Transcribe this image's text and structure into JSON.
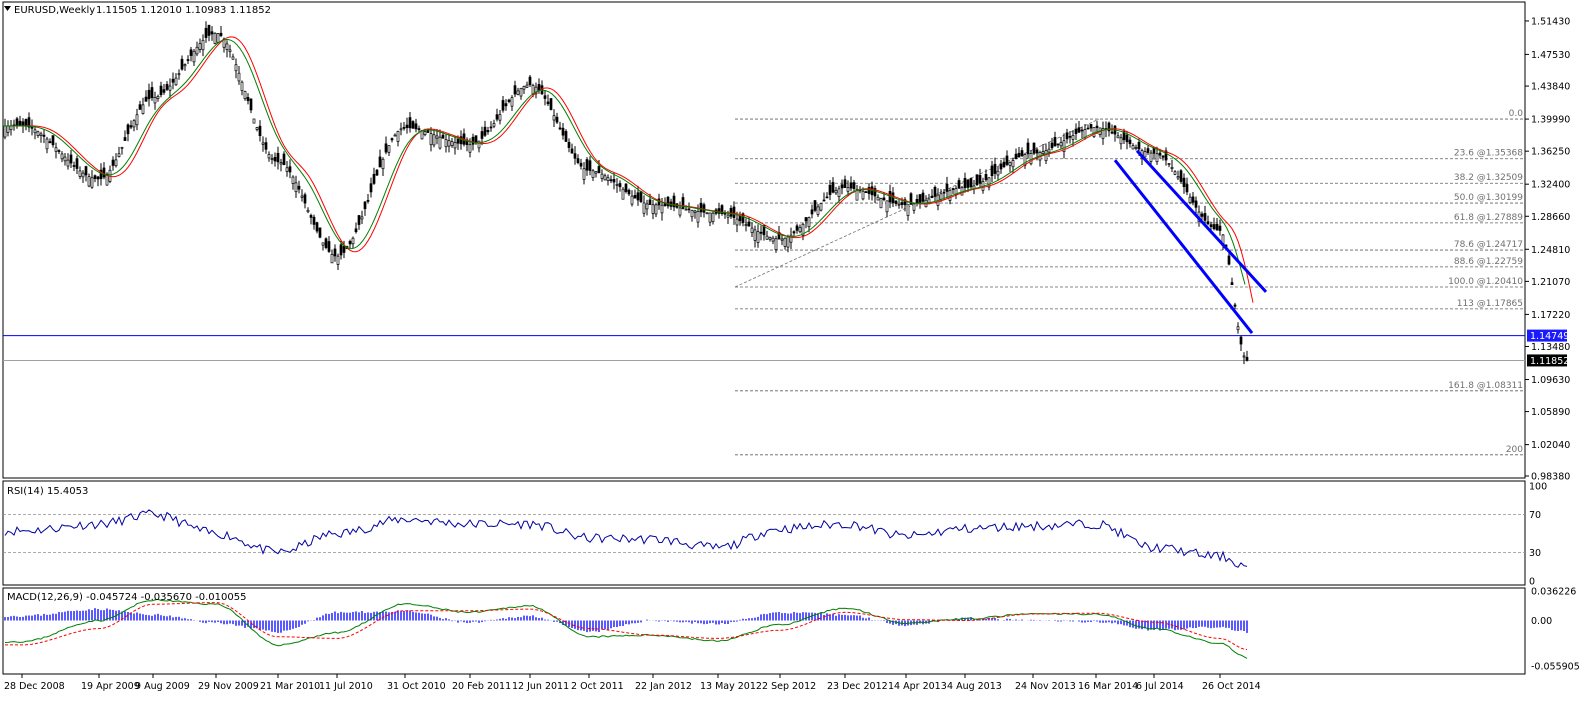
{
  "header": {
    "symbol_label": "EURUSD,Weekly",
    "ohlc": "1.11505 1.12010 1.10983 1.11852"
  },
  "colors": {
    "candles": "#000000",
    "ma_red": "#ff0000",
    "ma_green": "#008000",
    "channel": "#0000ff",
    "rsi": "#0000a0",
    "macd_line": "#008000",
    "macd_signal": "#ff0000",
    "macd_hist": "#0000ff",
    "fib": "#606060",
    "price_tag_bg": "#000000",
    "price_tag_blue": "#1a1aff"
  },
  "icons": {
    "window_menu": "triangle-down-icon"
  },
  "time_axis": [
    "28 Dec 2008",
    "19 Apr 2009",
    "9 Aug 2009",
    "29 Nov 2009",
    "21 Mar 2010",
    "11 Jul 2010",
    "31 Oct 2010",
    "20 Feb 2011",
    "12 Jun 2011",
    "2 Oct 2011",
    "22 Jan 2012",
    "13 May 2012",
    "2 Sep 2012",
    "23 Dec 2012",
    "14 Apr 2013",
    "4 Aug 2013",
    "24 Nov 2013",
    "16 Mar 2014",
    "6 Jul 2014",
    "26 Oct 2014"
  ],
  "chart_data": [
    {
      "type": "candlestick",
      "title": "EURUSD,Weekly",
      "ylim": [
        0.9838,
        1.5224
      ],
      "y_ticks": [
        "1.51430",
        "1.47530",
        "1.43840",
        "1.39990",
        "1.36250",
        "1.32400",
        "1.28660",
        "1.24810",
        "1.21070",
        "1.17220",
        "1.13480",
        "1.09630",
        "1.05890",
        "1.02040",
        "0.98380"
      ],
      "price_tags": [
        {
          "label": "1.14749",
          "value": 1.14749,
          "style": "blue-line"
        },
        {
          "label": "1.11852",
          "value": 1.11852,
          "style": "current"
        }
      ],
      "anchor_closes": [
        {
          "x": "28 Dec 2008",
          "y": 1.392
        },
        {
          "x": "19 Apr 2009",
          "y": 1.33
        },
        {
          "x": "9 Aug 2009",
          "y": 1.425
        },
        {
          "x": "29 Nov 2009",
          "y": 1.5
        },
        {
          "x": "21 Mar 2010",
          "y": 1.35
        },
        {
          "x": "11 Jul 2010",
          "y": 1.24
        },
        {
          "x": "31 Oct 2010",
          "y": 1.39
        },
        {
          "x": "20 Feb 2011",
          "y": 1.37
        },
        {
          "x": "12 Jun 2011",
          "y": 1.44
        },
        {
          "x": "2 Oct 2011",
          "y": 1.34
        },
        {
          "x": "22 Jan 2012",
          "y": 1.3
        },
        {
          "x": "13 May 2012",
          "y": 1.29
        },
        {
          "x": "2 Sep 2012",
          "y": 1.26
        },
        {
          "x": "23 Dec 2012",
          "y": 1.32
        },
        {
          "x": "14 Apr 2013",
          "y": 1.3
        },
        {
          "x": "4 Aug 2013",
          "y": 1.32
        },
        {
          "x": "24 Nov 2013",
          "y": 1.36
        },
        {
          "x": "16 Mar 2014",
          "y": 1.39
        },
        {
          "x": "6 Jul 2014",
          "y": 1.36
        },
        {
          "x": "26 Oct 2014",
          "y": 1.27
        },
        {
          "x": "last",
          "y": 1.11852
        }
      ],
      "fibonacci": [
        {
          "label": "0.0",
          "value": 1.3999
        },
        {
          "label": "23.6 @1.35368",
          "value": 1.35368
        },
        {
          "label": "38.2 @1.32509",
          "value": 1.32509
        },
        {
          "label": "50.0 @1.30199",
          "value": 1.30199
        },
        {
          "label": "61.8 @1.27889",
          "value": 1.27889
        },
        {
          "label": "78.6 @1.24717",
          "value": 1.24717
        },
        {
          "label": "88.6 @1.22759",
          "value": 1.22759
        },
        {
          "label": "100.0 @1.20410",
          "value": 1.2041
        },
        {
          "label": "113 @1.17865",
          "value": 1.17865
        },
        {
          "label": "161.8 @1.08311",
          "value": 1.08311
        },
        {
          "label": "200",
          "value": 1.0085
        }
      ]
    },
    {
      "type": "line",
      "title": "RSI(14) 15.4053",
      "ylim": [
        0,
        100
      ],
      "y_ticks": [
        "100",
        "70",
        "30",
        "0"
      ],
      "levels": [
        70,
        30
      ],
      "series": [
        {
          "name": "RSI(14)",
          "anchors": [
            {
              "x": "28 Dec 2008",
              "y": 53
            },
            {
              "x": "19 Apr 2009",
              "y": 60
            },
            {
              "x": "9 Aug 2009",
              "y": 70
            },
            {
              "x": "29 Nov 2009",
              "y": 50
            },
            {
              "x": "21 Mar 2010",
              "y": 30
            },
            {
              "x": "11 Jul 2010",
              "y": 50
            },
            {
              "x": "31 Oct 2010",
              "y": 65
            },
            {
              "x": "20 Feb 2011",
              "y": 60
            },
            {
              "x": "12 Jun 2011",
              "y": 60
            },
            {
              "x": "2 Oct 2011",
              "y": 45
            },
            {
              "x": "22 Jan 2012",
              "y": 44
            },
            {
              "x": "13 May 2012",
              "y": 35
            },
            {
              "x": "2 Sep 2012",
              "y": 55
            },
            {
              "x": "23 Dec 2012",
              "y": 60
            },
            {
              "x": "14 Apr 2013",
              "y": 47
            },
            {
              "x": "4 Aug 2013",
              "y": 55
            },
            {
              "x": "24 Nov 2013",
              "y": 58
            },
            {
              "x": "16 Mar 2014",
              "y": 60
            },
            {
              "x": "6 Jul 2014",
              "y": 35
            },
            {
              "x": "26 Oct 2014",
              "y": 26
            },
            {
              "x": "last",
              "y": 15.4053
            }
          ]
        }
      ]
    },
    {
      "type": "bar+line",
      "title": "MACD(12,26,9) -0.045724 -0.035670 -0.010055",
      "ylim": [
        -0.0559,
        0.03622
      ],
      "y_ticks": [
        "0.036226",
        "0.00",
        "-0.055905"
      ],
      "series": [
        {
          "name": "MACD",
          "anchors": [
            {
              "x": "28 Dec 2008",
              "y": -0.026
            },
            {
              "x": "19 Apr 2009",
              "y": 0.0
            },
            {
              "x": "9 Aug 2009",
              "y": 0.025
            },
            {
              "x": "29 Nov 2009",
              "y": 0.02
            },
            {
              "x": "21 Mar 2010",
              "y": -0.03
            },
            {
              "x": "11 Jul 2010",
              "y": -0.015
            },
            {
              "x": "31 Oct 2010",
              "y": 0.02
            },
            {
              "x": "20 Feb 2011",
              "y": 0.01
            },
            {
              "x": "12 Jun 2011",
              "y": 0.018
            },
            {
              "x": "2 Oct 2011",
              "y": -0.02
            },
            {
              "x": "22 Jan 2012",
              "y": -0.018
            },
            {
              "x": "13 May 2012",
              "y": -0.025
            },
            {
              "x": "2 Sep 2012",
              "y": -0.005
            },
            {
              "x": "23 Dec 2012",
              "y": 0.015
            },
            {
              "x": "14 Apr 2013",
              "y": -0.003
            },
            {
              "x": "4 Aug 2013",
              "y": 0.002
            },
            {
              "x": "24 Nov 2013",
              "y": 0.008
            },
            {
              "x": "16 Mar 2014",
              "y": 0.008
            },
            {
              "x": "6 Jul 2014",
              "y": -0.01
            },
            {
              "x": "26 Oct 2014",
              "y": -0.028
            },
            {
              "x": "last",
              "y": -0.045724
            }
          ]
        },
        {
          "name": "Signal",
          "anchors": [
            {
              "x": "28 Dec 2008",
              "y": -0.03
            },
            {
              "x": "19 Apr 2009",
              "y": -0.01
            },
            {
              "x": "9 Aug 2009",
              "y": 0.02
            },
            {
              "x": "29 Nov 2009",
              "y": 0.022
            },
            {
              "x": "21 Mar 2010",
              "y": -0.02
            },
            {
              "x": "11 Jul 2010",
              "y": -0.022
            },
            {
              "x": "31 Oct 2010",
              "y": 0.012
            },
            {
              "x": "20 Feb 2011",
              "y": 0.012
            },
            {
              "x": "12 Jun 2011",
              "y": 0.014
            },
            {
              "x": "2 Oct 2011",
              "y": -0.01
            },
            {
              "x": "22 Jan 2012",
              "y": -0.018
            },
            {
              "x": "13 May 2012",
              "y": -0.022
            },
            {
              "x": "2 Sep 2012",
              "y": -0.012
            },
            {
              "x": "23 Dec 2012",
              "y": 0.01
            },
            {
              "x": "14 Apr 2013",
              "y": 0.001
            },
            {
              "x": "4 Aug 2013",
              "y": 0.0
            },
            {
              "x": "24 Nov 2013",
              "y": 0.008
            },
            {
              "x": "16 Mar 2014",
              "y": 0.009
            },
            {
              "x": "6 Jul 2014",
              "y": -0.002
            },
            {
              "x": "26 Oct 2014",
              "y": -0.022
            },
            {
              "x": "last",
              "y": -0.03567
            }
          ]
        },
        {
          "name": "Histogram",
          "last": -0.010055
        }
      ]
    }
  ]
}
